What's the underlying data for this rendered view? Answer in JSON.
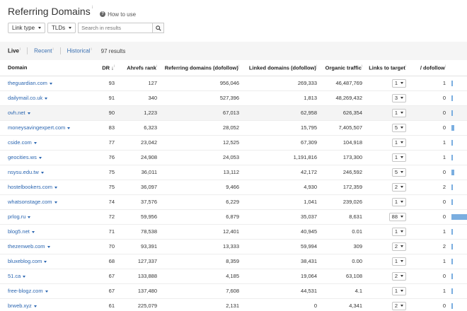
{
  "header": {
    "title": "Referring Domains",
    "title_info": "i",
    "how_to": "How to use"
  },
  "filters": {
    "link_type": "Link type",
    "tlds": "TLDs",
    "search_placeholder": "Search in results"
  },
  "tabs": [
    {
      "label": "Live",
      "info": "i",
      "active": true
    },
    {
      "label": "Recent",
      "info": "i",
      "active": false
    },
    {
      "label": "Historical",
      "info": "i",
      "active": false
    }
  ],
  "results_count": "97 results",
  "columns": {
    "domain": "Domain",
    "dr": "DR",
    "ahrefs_rank": "Ahrefs rank",
    "referring_domains": "Referring domains (dofollow)",
    "linked_domains": "Linked domains (dofollow)",
    "organic_traffic": "Organic traffic",
    "links_to_target": "Links to target",
    "dofollow": "/ dofollow"
  },
  "rows": [
    {
      "domain": "theguardian.com",
      "dr": "93",
      "rank": "127",
      "ref": "956,046",
      "linked": "269,333",
      "traffic": "46,487,769",
      "links": "1",
      "dofollow": "1",
      "bar": 0.04
    },
    {
      "domain": "dailymail.co.uk",
      "dr": "91",
      "rank": "340",
      "ref": "527,396",
      "linked": "1,813",
      "traffic": "48,269,432",
      "links": "3",
      "dofollow": "0",
      "bar": 0.04
    },
    {
      "domain": "ovh.net",
      "dr": "90",
      "rank": "1,223",
      "ref": "67,013",
      "linked": "62,958",
      "traffic": "626,354",
      "links": "1",
      "dofollow": "0",
      "bar": 0.04
    },
    {
      "domain": "moneysavingexpert.com",
      "dr": "83",
      "rank": "6,323",
      "ref": "28,052",
      "linked": "15,795",
      "traffic": "7,405,507",
      "links": "5",
      "dofollow": "0",
      "bar": 0.2
    },
    {
      "domain": "cside.com",
      "dr": "77",
      "rank": "23,042",
      "ref": "12,525",
      "linked": "67,309",
      "traffic": "104,918",
      "links": "1",
      "dofollow": "1",
      "bar": 0.04
    },
    {
      "domain": "geocities.ws",
      "dr": "76",
      "rank": "24,908",
      "ref": "24,053",
      "linked": "1,191,816",
      "traffic": "173,300",
      "links": "1",
      "dofollow": "1",
      "bar": 0.04
    },
    {
      "domain": "nsysu.edu.tw",
      "dr": "75",
      "rank": "36,011",
      "ref": "13,112",
      "linked": "42,172",
      "traffic": "246,592",
      "links": "5",
      "dofollow": "0",
      "bar": 0.2
    },
    {
      "domain": "hostelbookers.com",
      "dr": "75",
      "rank": "36,097",
      "ref": "9,466",
      "linked": "4,930",
      "traffic": "172,359",
      "links": "2",
      "dofollow": "2",
      "bar": 0.08
    },
    {
      "domain": "whatsonstage.com",
      "dr": "74",
      "rank": "37,576",
      "ref": "6,229",
      "linked": "1,041",
      "traffic": "239,026",
      "links": "1",
      "dofollow": "0",
      "bar": 0.04
    },
    {
      "domain": "prlog.ru",
      "dr": "72",
      "rank": "59,956",
      "ref": "6,879",
      "linked": "35,037",
      "traffic": "8,631",
      "links": "88",
      "dofollow": "0",
      "bar": 1.0
    },
    {
      "domain": "blog5.net",
      "dr": "71",
      "rank": "78,538",
      "ref": "12,401",
      "linked": "40,945",
      "traffic": "0.01",
      "links": "1",
      "dofollow": "1",
      "bar": 0.04
    },
    {
      "domain": "thezenweb.com",
      "dr": "70",
      "rank": "93,391",
      "ref": "13,333",
      "linked": "59,994",
      "traffic": "309",
      "links": "2",
      "dofollow": "2",
      "bar": 0.08
    },
    {
      "domain": "bluxeblog.com",
      "dr": "68",
      "rank": "127,337",
      "ref": "8,359",
      "linked": "38,431",
      "traffic": "0.00",
      "links": "1",
      "dofollow": "1",
      "bar": 0.04
    },
    {
      "domain": "51.ca",
      "dr": "67",
      "rank": "133,888",
      "ref": "4,185",
      "linked": "19,064",
      "traffic": "63,108",
      "links": "2",
      "dofollow": "0",
      "bar": 0.08
    },
    {
      "domain": "free-blogz.com",
      "dr": "67",
      "rank": "137,480",
      "ref": "7,608",
      "linked": "44,531",
      "traffic": "4.1",
      "links": "1",
      "dofollow": "1",
      "bar": 0.04
    },
    {
      "domain": "brweb.xyz",
      "dr": "61",
      "rank": "225,079",
      "ref": "2,131",
      "linked": "0",
      "traffic": "4,341",
      "links": "2",
      "dofollow": "0",
      "bar": 0.08
    }
  ],
  "colors": {
    "link": "#2b66b1",
    "bar": "#7aaee0"
  }
}
